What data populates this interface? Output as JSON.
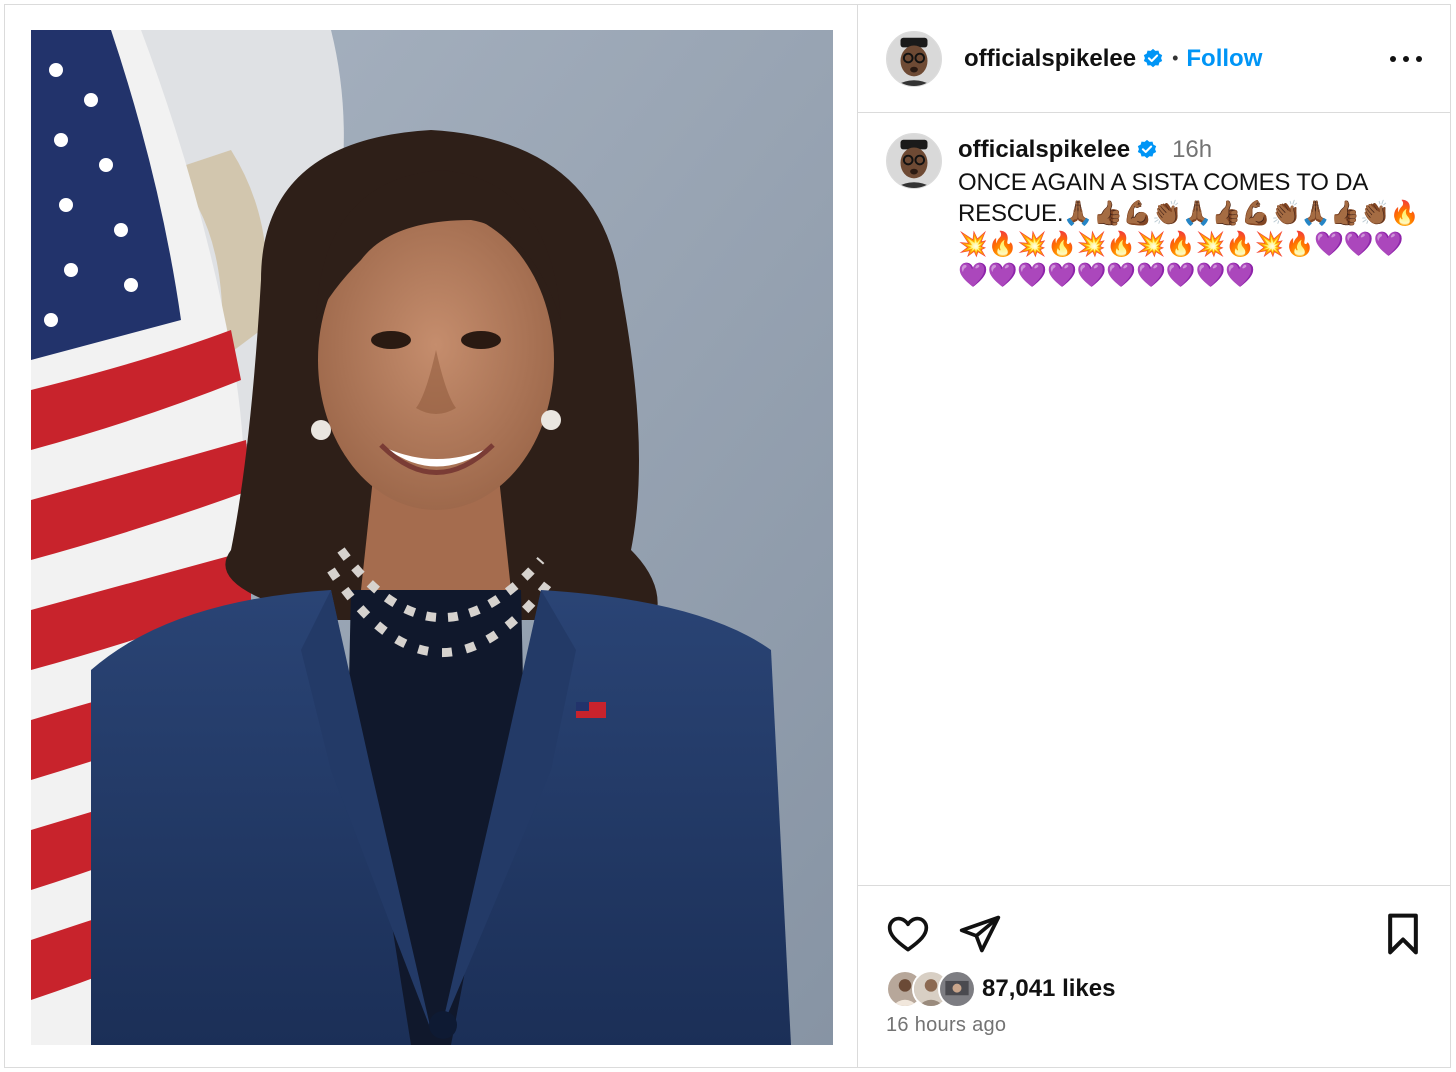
{
  "header": {
    "username": "officialspikelee",
    "separator": "•",
    "follow_label": "Follow",
    "more_icon": "more-horizontal-icon",
    "verified_icon": "verified-badge-icon"
  },
  "caption": {
    "username": "officialspikelee",
    "time": "16h",
    "text": "ONCE AGAIN A SISTA COMES TO DA RESCUE.🙏🏾👍🏾💪🏾👏🏾🙏🏾👍🏾💪🏾👏🏾🙏🏾👍🏾👏🏾🔥💥🔥💥🔥💥🔥💥🔥💥🔥💥🔥💜💜💜💜💜💜💜💜💜💜💜💜💜"
  },
  "actions": {
    "like_icon": "heart-icon",
    "share_icon": "send-icon",
    "save_icon": "bookmark-icon"
  },
  "engagement": {
    "likes": "87,041 likes",
    "posted": "16 hours ago"
  },
  "colors": {
    "accent": "#0095f6",
    "border": "#dbdbdb",
    "muted": "#737373",
    "verified": "#0095f6"
  }
}
